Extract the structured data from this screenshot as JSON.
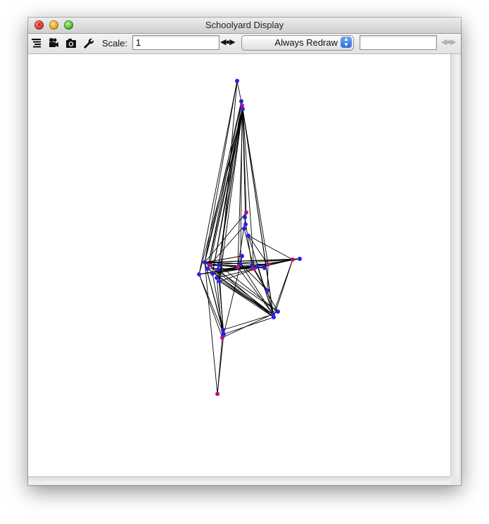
{
  "window": {
    "title": "Schoolyard Display",
    "controls": [
      "close",
      "minimize",
      "zoom"
    ]
  },
  "toolbar": {
    "icons": [
      "list-icon",
      "movie-camera-icon",
      "camera-icon",
      "wrench-icon"
    ],
    "scale_label": "Scale:",
    "scale_value": "1",
    "redraw_selected": "Always Redraw",
    "right_field_value": ""
  },
  "colors": {
    "edge": "#000000",
    "node_blue": "#2d1ee8",
    "node_magenta": "#b01580"
  },
  "network": {
    "description_free": true,
    "node_colors": [
      "blue",
      "magenta",
      "purple"
    ]
  }
}
